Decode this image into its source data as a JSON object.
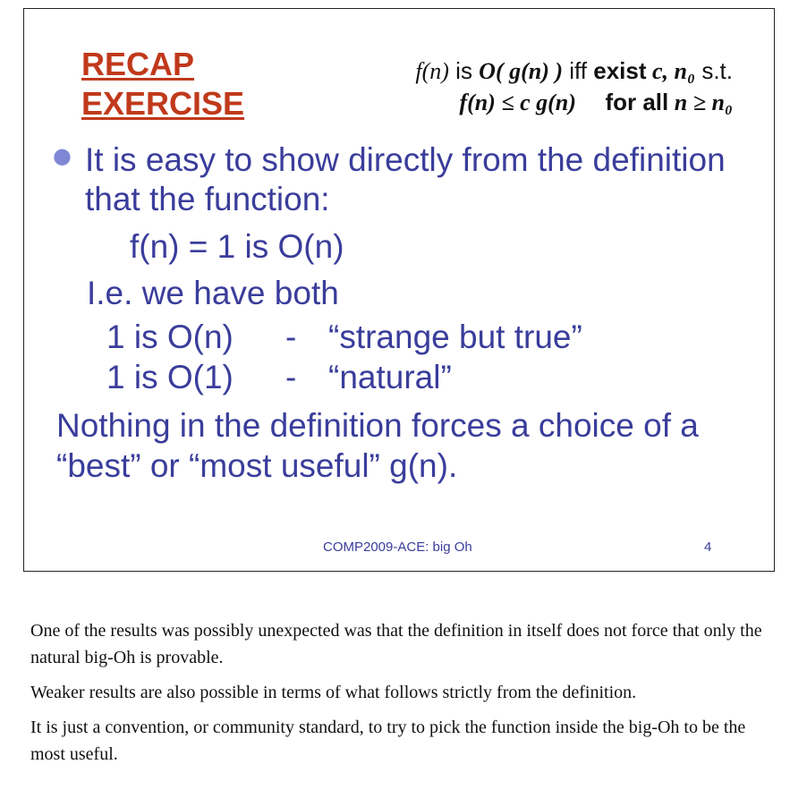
{
  "slide": {
    "title_line1": "RECAP",
    "title_line2": "EXERCISE",
    "definition": {
      "line1_f": "f(n)",
      "line1_is": " is ",
      "line1_O": "O( g(n) )",
      "line1_iff": " iff ",
      "line1_exist": "exist",
      "line1_vars": " c, n₀",
      "line1_st": " s.t.",
      "line2_ineq": "f(n) ≤ c g(n)",
      "line2_forall": "for all",
      "line2_cond": " n ≥ n₀"
    },
    "bullet_text": "It is easy to show directly from the definition that the function:",
    "formula": "f(n) = 1  is O(n)",
    "ie_line": "I.e. we have both",
    "rows": [
      {
        "left": "1 is O(n)",
        "dash": "-",
        "right": "“strange but true”"
      },
      {
        "left": "1 is O(1)",
        "dash": "-",
        "right": "“natural”"
      }
    ],
    "conclusion": "Nothing in the definition forces a choice of a “best” or “most useful” g(n).",
    "footer_course": "COMP2009-ACE: big Oh",
    "footer_page": "4"
  },
  "notes": [
    "One of the results was possibly unexpected was that the definition in itself does not force that only the natural big-Oh is provable.",
    "Weaker results are also possible in terms of what follows strictly from the definition.",
    "It is just a convention, or community standard, to try to pick the function inside the big-Oh to be the most useful."
  ]
}
